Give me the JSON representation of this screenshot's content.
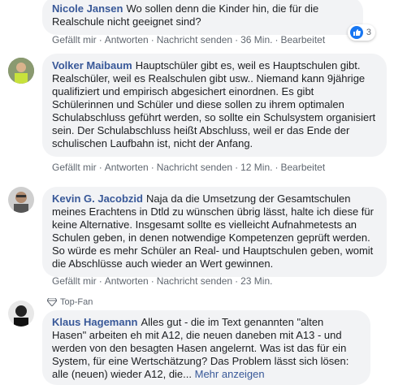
{
  "comments": [
    {
      "author": "Nicole Jansen",
      "text": "Wo sollen denn die Kinder hin, die für die Realschule nicht geeignet sind?",
      "actions": [
        "Gefällt mir",
        "Antworten",
        "Nachricht senden",
        "36 Min.",
        "Bearbeitet"
      ],
      "likes": "3"
    },
    {
      "author": "Volker Maibaum",
      "text": "Hauptschüler gibt es, weil es Hauptschulen gibt. Realschüler, weil es Realschulen gibt usw.. Niemand kann 9jährige qualifiziert und empirisch abgesichert einordnen. Es gibt Schülerinnen und Schüler und diese sollen zu ihrem optimalen Schulabschluss geführt werden, so sollte ein Schulsystem organisiert sein. Der Schulabschluss heißt Abschluss, weil er das Ende der schulischen Laufbahn ist, nicht der Anfang.",
      "actions": [
        "Gefällt mir",
        "Antworten",
        "Nachricht senden",
        "12 Min.",
        "Bearbeitet"
      ]
    },
    {
      "author": "Kevin G. Jacobzid",
      "text": "Naja da die Umsetzung der Gesamtschulen meines Erachtens in Dtld zu wünschen übrig lässt, halte ich diese für keine Alternative. Insgesamt sollte es vielleicht Aufnahmetests an Schulen geben, in denen notwendige Kompetenzen geprüft werden. So würde es mehr Schüler an Real- und Hauptschulen geben, womit die Abschlüsse auch wieder an Wert gewinnen.",
      "actions": [
        "Gefällt mir",
        "Antworten",
        "Nachricht senden",
        "23 Min."
      ]
    },
    {
      "badge": "Top-Fan",
      "author": "Klaus Hagemann",
      "text": "Alles gut - die im Text genannten \"alten Hasen\" arbeiten eh mit A12, die neuen daneben mit A13 - und werden von den besagten Hasen angelernt. Was ist das für ein System, für eine Wertschätzung? Das Problem lässt sich lösen: alle (neuen) wieder A12, die...",
      "more": "Mehr anzeigen"
    }
  ],
  "colors": {
    "author": "#385898",
    "bubble": "#f2f3f5",
    "meta": "#606770",
    "like": "#1877f2"
  }
}
